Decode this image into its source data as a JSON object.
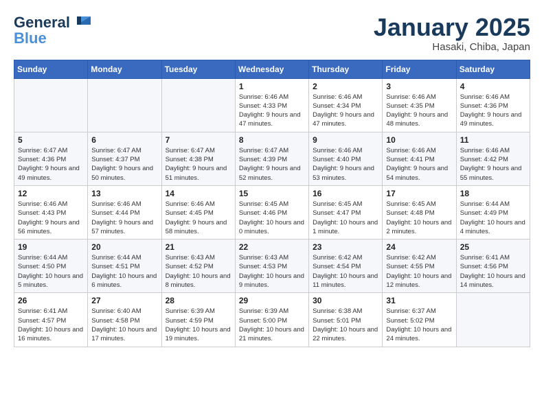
{
  "header": {
    "logo_line1": "General",
    "logo_line2": "Blue",
    "month_title": "January 2025",
    "subtitle": "Hasaki, Chiba, Japan"
  },
  "weekdays": [
    "Sunday",
    "Monday",
    "Tuesday",
    "Wednesday",
    "Thursday",
    "Friday",
    "Saturday"
  ],
  "weeks": [
    [
      {
        "day": "",
        "info": ""
      },
      {
        "day": "",
        "info": ""
      },
      {
        "day": "",
        "info": ""
      },
      {
        "day": "1",
        "info": "Sunrise: 6:46 AM\nSunset: 4:33 PM\nDaylight: 9 hours and 47 minutes."
      },
      {
        "day": "2",
        "info": "Sunrise: 6:46 AM\nSunset: 4:34 PM\nDaylight: 9 hours and 47 minutes."
      },
      {
        "day": "3",
        "info": "Sunrise: 6:46 AM\nSunset: 4:35 PM\nDaylight: 9 hours and 48 minutes."
      },
      {
        "day": "4",
        "info": "Sunrise: 6:46 AM\nSunset: 4:36 PM\nDaylight: 9 hours and 49 minutes."
      }
    ],
    [
      {
        "day": "5",
        "info": "Sunrise: 6:47 AM\nSunset: 4:36 PM\nDaylight: 9 hours and 49 minutes."
      },
      {
        "day": "6",
        "info": "Sunrise: 6:47 AM\nSunset: 4:37 PM\nDaylight: 9 hours and 50 minutes."
      },
      {
        "day": "7",
        "info": "Sunrise: 6:47 AM\nSunset: 4:38 PM\nDaylight: 9 hours and 51 minutes."
      },
      {
        "day": "8",
        "info": "Sunrise: 6:47 AM\nSunset: 4:39 PM\nDaylight: 9 hours and 52 minutes."
      },
      {
        "day": "9",
        "info": "Sunrise: 6:46 AM\nSunset: 4:40 PM\nDaylight: 9 hours and 53 minutes."
      },
      {
        "day": "10",
        "info": "Sunrise: 6:46 AM\nSunset: 4:41 PM\nDaylight: 9 hours and 54 minutes."
      },
      {
        "day": "11",
        "info": "Sunrise: 6:46 AM\nSunset: 4:42 PM\nDaylight: 9 hours and 55 minutes."
      }
    ],
    [
      {
        "day": "12",
        "info": "Sunrise: 6:46 AM\nSunset: 4:43 PM\nDaylight: 9 hours and 56 minutes."
      },
      {
        "day": "13",
        "info": "Sunrise: 6:46 AM\nSunset: 4:44 PM\nDaylight: 9 hours and 57 minutes."
      },
      {
        "day": "14",
        "info": "Sunrise: 6:46 AM\nSunset: 4:45 PM\nDaylight: 9 hours and 58 minutes."
      },
      {
        "day": "15",
        "info": "Sunrise: 6:45 AM\nSunset: 4:46 PM\nDaylight: 10 hours and 0 minutes."
      },
      {
        "day": "16",
        "info": "Sunrise: 6:45 AM\nSunset: 4:47 PM\nDaylight: 10 hours and 1 minute."
      },
      {
        "day": "17",
        "info": "Sunrise: 6:45 AM\nSunset: 4:48 PM\nDaylight: 10 hours and 2 minutes."
      },
      {
        "day": "18",
        "info": "Sunrise: 6:44 AM\nSunset: 4:49 PM\nDaylight: 10 hours and 4 minutes."
      }
    ],
    [
      {
        "day": "19",
        "info": "Sunrise: 6:44 AM\nSunset: 4:50 PM\nDaylight: 10 hours and 5 minutes."
      },
      {
        "day": "20",
        "info": "Sunrise: 6:44 AM\nSunset: 4:51 PM\nDaylight: 10 hours and 6 minutes."
      },
      {
        "day": "21",
        "info": "Sunrise: 6:43 AM\nSunset: 4:52 PM\nDaylight: 10 hours and 8 minutes."
      },
      {
        "day": "22",
        "info": "Sunrise: 6:43 AM\nSunset: 4:53 PM\nDaylight: 10 hours and 9 minutes."
      },
      {
        "day": "23",
        "info": "Sunrise: 6:42 AM\nSunset: 4:54 PM\nDaylight: 10 hours and 11 minutes."
      },
      {
        "day": "24",
        "info": "Sunrise: 6:42 AM\nSunset: 4:55 PM\nDaylight: 10 hours and 12 minutes."
      },
      {
        "day": "25",
        "info": "Sunrise: 6:41 AM\nSunset: 4:56 PM\nDaylight: 10 hours and 14 minutes."
      }
    ],
    [
      {
        "day": "26",
        "info": "Sunrise: 6:41 AM\nSunset: 4:57 PM\nDaylight: 10 hours and 16 minutes."
      },
      {
        "day": "27",
        "info": "Sunrise: 6:40 AM\nSunset: 4:58 PM\nDaylight: 10 hours and 17 minutes."
      },
      {
        "day": "28",
        "info": "Sunrise: 6:39 AM\nSunset: 4:59 PM\nDaylight: 10 hours and 19 minutes."
      },
      {
        "day": "29",
        "info": "Sunrise: 6:39 AM\nSunset: 5:00 PM\nDaylight: 10 hours and 21 minutes."
      },
      {
        "day": "30",
        "info": "Sunrise: 6:38 AM\nSunset: 5:01 PM\nDaylight: 10 hours and 22 minutes."
      },
      {
        "day": "31",
        "info": "Sunrise: 6:37 AM\nSunset: 5:02 PM\nDaylight: 10 hours and 24 minutes."
      },
      {
        "day": "",
        "info": ""
      }
    ]
  ]
}
